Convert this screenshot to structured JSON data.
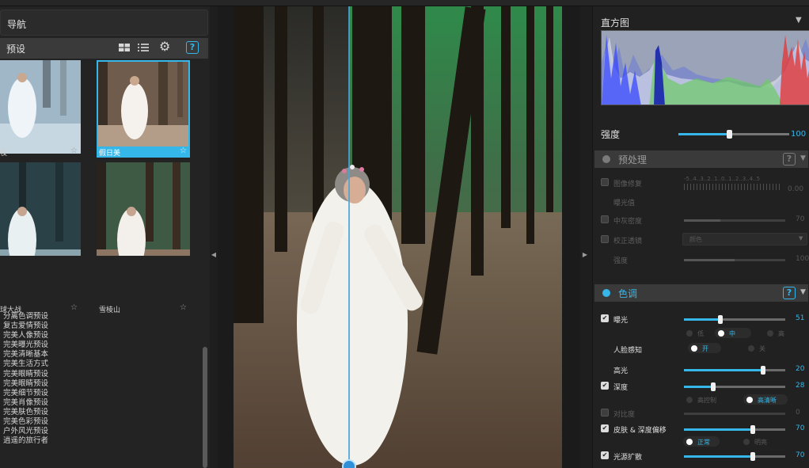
{
  "left_panel": {
    "nav_title": "导航",
    "presets_title": "预设",
    "help_glyph": "?",
    "header_icons": [
      "grid-view-icon",
      "list-view-icon",
      "gear-icon",
      "help-icon"
    ],
    "thumbnails": [
      {
        "label": "夜",
        "selected": false
      },
      {
        "label": "假日美",
        "selected": true
      },
      {
        "label": "球大战",
        "selected": false
      },
      {
        "label": "雪棱山",
        "selected": false
      }
    ],
    "preset_list": [
      "分离色调预设",
      "复古爱情预设",
      "完美人像预设",
      "完美曝光预设",
      "完美清晰基本",
      "完美生活方式",
      "完美眼睛预设",
      "完美眼睛预设",
      "完美细节预设",
      "完美肖像预设",
      "完美肤色预设",
      "完美色彩预设",
      "户外风光预设",
      "逍遥的旅行者"
    ]
  },
  "histogram": {
    "title": "直方图",
    "series_colors": [
      "#2020ff",
      "#20ff40",
      "#ff2020",
      "#ffffff"
    ]
  },
  "strength": {
    "label": "强度",
    "value": "100",
    "fraction": 0.46
  },
  "preprocess": {
    "title": "预处理",
    "help_glyph": "?",
    "rows": [
      {
        "label": "图像修复",
        "enabled": false,
        "scale": "-5..4..3..2..1..0..1..2..3..4..5",
        "value": "0.00"
      },
      {
        "label": "曝光值"
      },
      {
        "label": "中灰密度",
        "enabled": false,
        "value": "70",
        "fraction": 0.36
      },
      {
        "label": "校正透镜",
        "enabled": false,
        "select": "颜色"
      },
      {
        "label": "强度",
        "value": "100",
        "fraction": 0.5
      }
    ]
  },
  "tone": {
    "title": "色调",
    "help_glyph": "?",
    "rows": [
      {
        "label": "曝光",
        "enabled": true,
        "value": "51",
        "fraction": 0.36
      },
      {
        "radios": [
          "低",
          "中",
          "高"
        ],
        "selected": 1
      },
      {
        "label": "人脸感知",
        "radios": [
          "开",
          "关"
        ],
        "selected": 0
      },
      {
        "label": "高光",
        "value": "20",
        "fraction": 0.78
      },
      {
        "label": "深度",
        "enabled": true,
        "value": "28",
        "fraction": 0.29
      },
      {
        "radios": [
          "高控制",
          "高清晰"
        ],
        "selected": 1
      },
      {
        "label": "对比度",
        "enabled": false,
        "value": "0",
        "fraction": 0.0
      },
      {
        "label": "皮肤 & 深度偏移",
        "enabled": true,
        "value": "70",
        "fraction": 0.68
      },
      {
        "radios": [
          "正常",
          "明亮"
        ],
        "selected": 0
      },
      {
        "label": "光源扩散",
        "enabled": true,
        "value": "70",
        "fraction": 0.68
      }
    ]
  },
  "colors": {
    "accent": "#36b7ea",
    "panel": "#232323",
    "header": "#3a3a3a"
  }
}
